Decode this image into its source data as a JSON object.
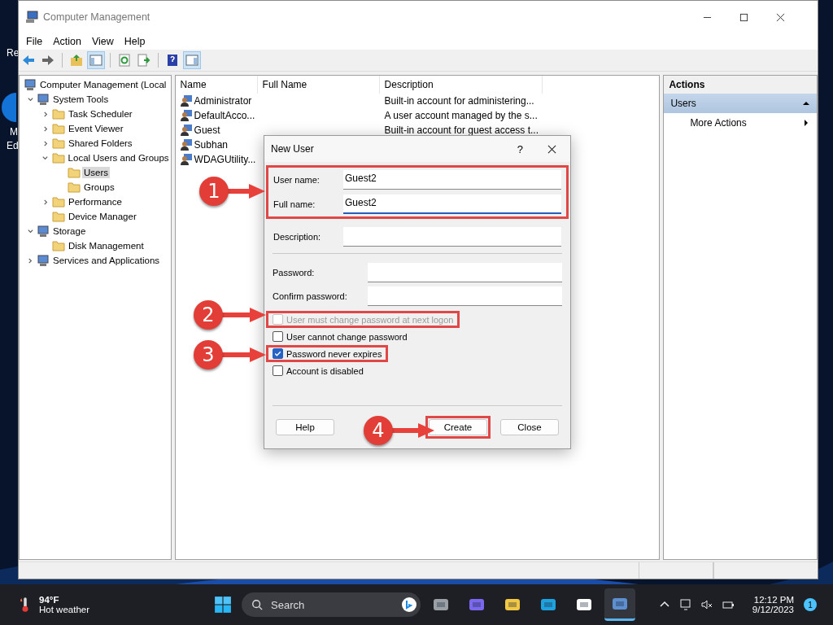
{
  "desktop_labels": [
    "Re",
    "M",
    "Ed"
  ],
  "window": {
    "title": "Computer Management",
    "menu": [
      "File",
      "Action",
      "View",
      "Help"
    ],
    "tree": [
      {
        "label": "Computer Management (Local",
        "selected": false,
        "children": [
          {
            "label": "System Tools",
            "expanded": true,
            "selected": false,
            "children": [
              {
                "label": "Task Scheduler",
                "expanded": false,
                "selected": false
              },
              {
                "label": "Event Viewer",
                "expanded": false,
                "selected": false
              },
              {
                "label": "Shared Folders",
                "expanded": false,
                "selected": false
              },
              {
                "label": "Local Users and Groups",
                "expanded": true,
                "selected": false,
                "children": [
                  {
                    "label": "Users",
                    "selected": true
                  },
                  {
                    "label": "Groups",
                    "selected": false
                  }
                ]
              },
              {
                "label": "Performance",
                "expanded": false,
                "selected": false
              },
              {
                "label": "Device Manager",
                "selected": false
              }
            ]
          },
          {
            "label": "Storage",
            "expanded": true,
            "selected": false,
            "children": [
              {
                "label": "Disk Management",
                "selected": false
              }
            ]
          },
          {
            "label": "Services and Applications",
            "expanded": false,
            "selected": false
          }
        ]
      }
    ],
    "columns": [
      "Name",
      "Full Name",
      "Description"
    ],
    "rows": [
      {
        "name": "Administrator",
        "description": "Built-in account for administering..."
      },
      {
        "name": "DefaultAcco...",
        "description": "A user account managed by the s..."
      },
      {
        "name": "Guest",
        "description": "Built-in account for guest access t..."
      },
      {
        "name": "Subhan"
      },
      {
        "name": "WDAGUtility..."
      }
    ],
    "actions": {
      "header": "Actions",
      "section": "Users",
      "expanded": true,
      "items": [
        "More Actions"
      ]
    }
  },
  "dialog": {
    "title": "New User",
    "help": "?",
    "fields": [
      {
        "label": "User name:",
        "value": "Guest2",
        "highlighted": true,
        "focused": false
      },
      {
        "label": "Full name:",
        "value": "Guest2",
        "highlighted": true,
        "focused": true
      },
      {
        "label": "Description:",
        "highlighted": false,
        "focused": false
      }
    ],
    "password_fields": [
      {
        "label": "Password:"
      },
      {
        "label": "Confirm password:"
      }
    ],
    "checkboxes": [
      {
        "label": "User must change password at next logon",
        "checked": false,
        "disabled": true,
        "highlighted": true
      },
      {
        "label": "User cannot change password",
        "checked": false,
        "disabled": false,
        "highlighted": false
      },
      {
        "label": "Password never expires",
        "checked": true,
        "disabled": false,
        "highlighted": true
      },
      {
        "label": "Account is disabled",
        "checked": false,
        "disabled": false,
        "highlighted": false
      }
    ],
    "buttons": [
      {
        "label": "Help",
        "highlighted": false
      },
      {
        "label": "Create",
        "highlighted": true
      },
      {
        "label": "Close",
        "highlighted": false
      }
    ]
  },
  "callouts": [
    "1",
    "2",
    "3",
    "4"
  ],
  "taskbar": {
    "temperature": "94°F",
    "weather": "Hot weather",
    "search": {
      "placeholder": "Search"
    },
    "apps": [
      {
        "selected": false
      },
      {
        "selected": false
      },
      {
        "selected": false
      },
      {
        "selected": false
      },
      {
        "selected": false
      },
      {
        "selected": true
      }
    ],
    "time": "12:12 PM",
    "date": "9/12/2023",
    "notifications": "1"
  }
}
